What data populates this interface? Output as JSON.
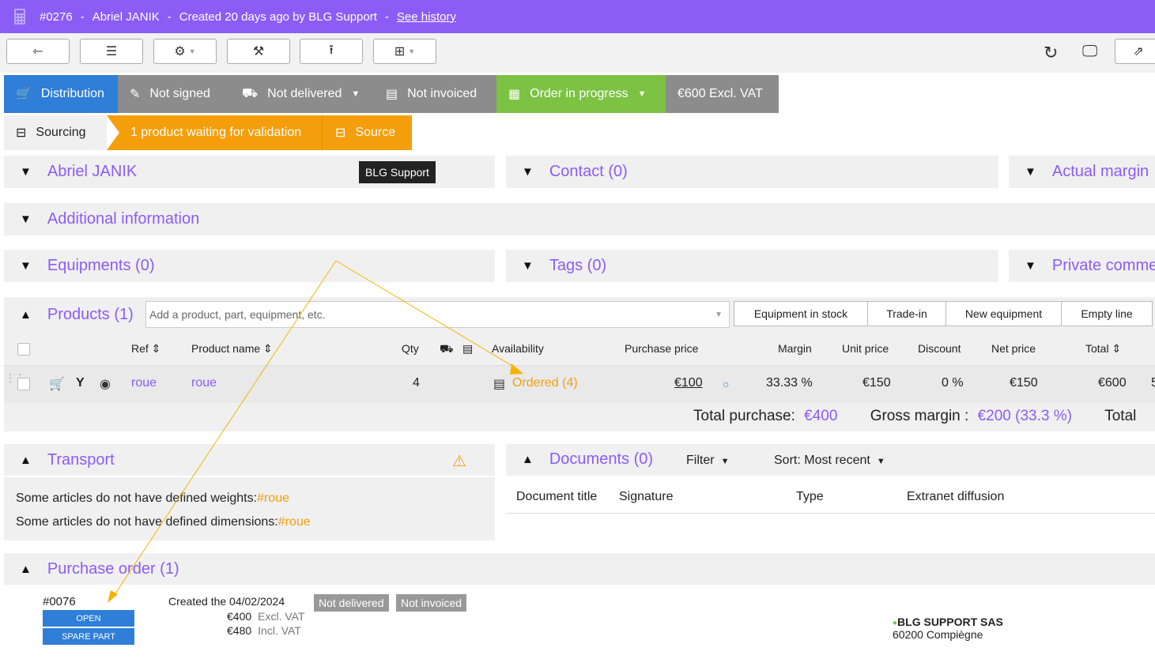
{
  "header": {
    "ref": "#0276",
    "client": "Abriel JANIK",
    "created": "Created 20 days ago by BLG Support",
    "history_link": "See history"
  },
  "status": {
    "distribution": "Distribution",
    "signed": "Not signed",
    "delivered": "Not delivered",
    "invoiced": "Not invoiced",
    "order": "Order in progress",
    "amount": "€600 Excl. VAT"
  },
  "sourcing": {
    "label": "Sourcing",
    "waiting": "1 product waiting for validation",
    "source_button": "Source"
  },
  "panels": {
    "client_name": "Abriel JANIK",
    "client_tooltip": "BLG Support",
    "contact": "Contact (0)",
    "actual_margin": "Actual margin",
    "additional_info": "Additional information",
    "equipments": "Equipments (0)",
    "tags": "Tags (0)",
    "private_comments": "Private comme"
  },
  "products": {
    "title": "Products (1)",
    "search_placeholder": "Add a product, part, equipment, etc.",
    "buttons": [
      "Equipment in stock",
      "Trade-in",
      "New equipment",
      "Empty line"
    ],
    "columns": {
      "ref": "Ref ⇕",
      "name": "Product name ⇕",
      "qty": "Qty",
      "availability": "Availability",
      "purchase_price": "Purchase price",
      "margin": "Margin",
      "unit_price": "Unit price",
      "discount": "Discount",
      "net_price": "Net price",
      "total": "Total ⇕"
    },
    "row": {
      "ref": "roue",
      "name": "roue",
      "qty": "4",
      "availability": "Ordered (4)",
      "purchase_price": "€100",
      "margin": "33.33 %",
      "unit_price": "€150",
      "discount": "0 %",
      "net_price": "€150",
      "total": "€600",
      "trailing": "5"
    },
    "totals": {
      "purchase_label": "Total purchase:",
      "purchase_value": "€400",
      "margin_label": "Gross margin :",
      "margin_value": "€200 (33.3 %)",
      "total_label": "Total"
    }
  },
  "transport": {
    "title": "Transport",
    "line1_text": "Some articles do not have defined weights:",
    "line1_link": "#roue",
    "line2_text": "Some articles do not have defined dimensions:",
    "line2_link": "#roue"
  },
  "documents": {
    "title": "Documents (0)",
    "filter": "Filter",
    "sort": "Sort: Most recent",
    "columns": [
      "Document title",
      "Signature",
      "Type",
      "Extranet diffusion"
    ]
  },
  "purchase_order": {
    "title": "Purchase order (1)",
    "ref": "#0076",
    "open": "OPEN",
    "type": "SPARE PART",
    "created": "Created the 04/02/2024",
    "not_delivered": "Not delivered",
    "not_invoiced": "Not invoiced",
    "excl_amount": "€400",
    "excl_label": "Excl. VAT",
    "incl_amount": "€480",
    "incl_label": "Incl. VAT",
    "supplier": "BLG SUPPORT SAS",
    "supplier_city": "60200 Compiègne"
  },
  "colors": {
    "purple": "#8b5cf6",
    "blue": "#2f7ed8",
    "gray": "#8c8c8c",
    "green": "#7cc243",
    "orange": "#f59e0b"
  }
}
